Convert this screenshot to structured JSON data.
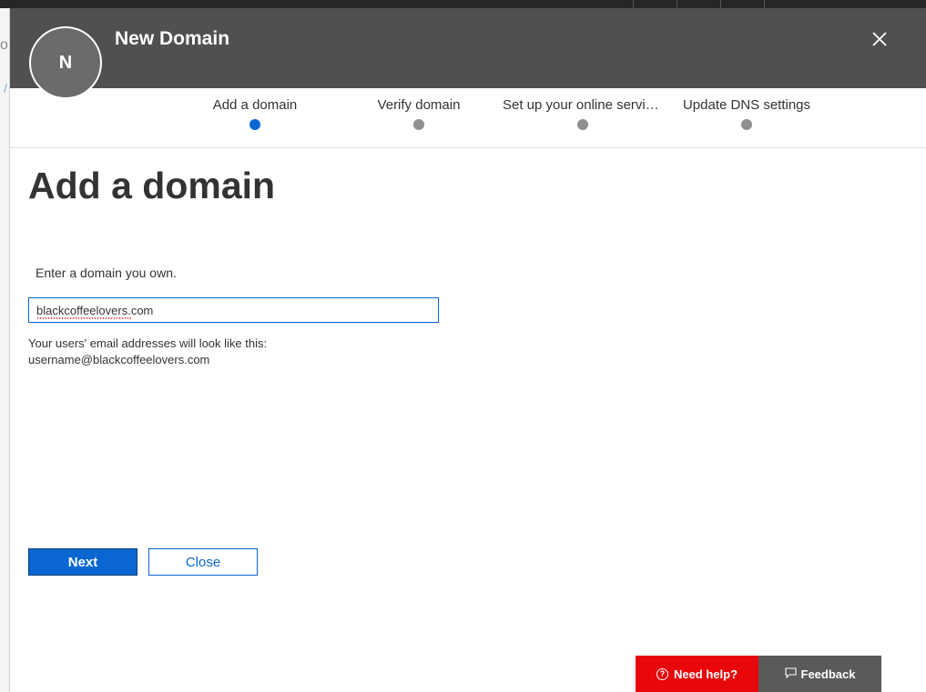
{
  "panel": {
    "title": "New Domain",
    "avatar_initial": "N",
    "close_icon": "close-icon"
  },
  "steps": [
    {
      "label": "Add a domain",
      "state": "active"
    },
    {
      "label": "Verify domain",
      "state": "pending"
    },
    {
      "label": "Set up your online services",
      "state": "pending"
    },
    {
      "label": "Update DNS settings",
      "state": "pending"
    }
  ],
  "main": {
    "heading": "Add a domain",
    "field_label": "Enter a domain you own.",
    "domain_value": "blackcoffeelovers.com",
    "hint_line1": "Your users' email addresses will look like this:",
    "hint_line2": "username@blackcoffeelovers.com"
  },
  "buttons": {
    "next": "Next",
    "close": "Close"
  },
  "footer": {
    "help_label": "Need help?",
    "feedback_label": "Feedback"
  },
  "colors": {
    "accent": "#0a67d1",
    "header": "#505050",
    "help": "#e8070b"
  }
}
